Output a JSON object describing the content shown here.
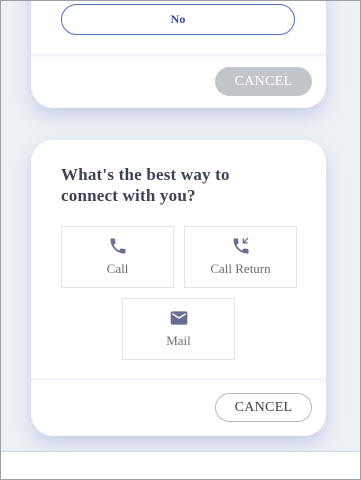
{
  "top_card": {
    "no_label": "No",
    "cancel_label": "CANCEL"
  },
  "main_card": {
    "question": "What's the best way to connect with you?",
    "options": [
      {
        "label": "Call",
        "icon": "phone-icon"
      },
      {
        "label": "Call Return",
        "icon": "phone-callback-icon"
      },
      {
        "label": "Mail",
        "icon": "envelope-icon"
      }
    ],
    "cancel_label": "CANCEL"
  },
  "colors": {
    "icon": "#6a6d90",
    "accent_border": "#4f6fc4",
    "disabled_button": "#c2c5ca"
  }
}
